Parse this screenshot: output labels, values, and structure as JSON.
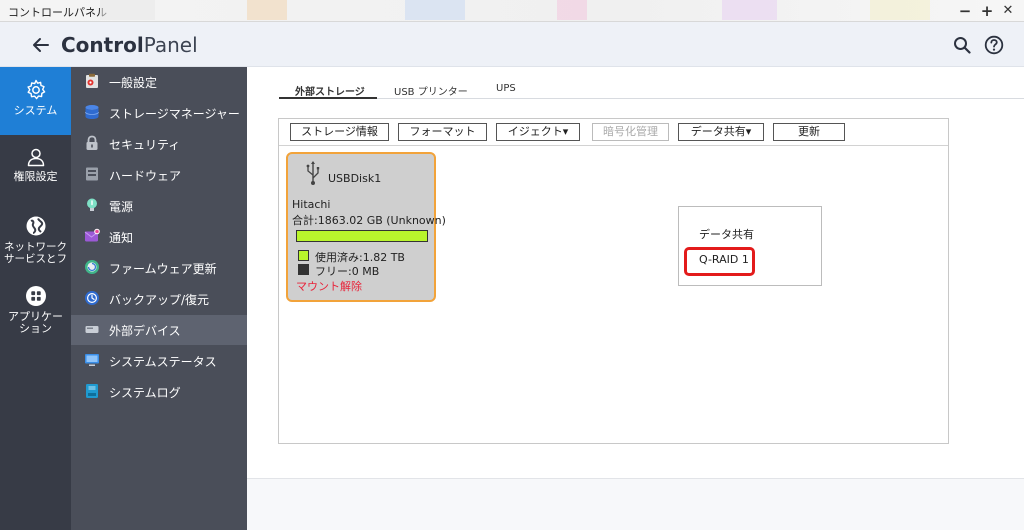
{
  "window": {
    "title": "コントロールパネル",
    "minimize": "−",
    "maximize": "+",
    "close": "✕"
  },
  "header": {
    "title_strong": "Control",
    "title_light": "Panel"
  },
  "primary_nav": [
    {
      "label": "システム",
      "icon": "gear-icon",
      "active": true
    },
    {
      "label": "権限設定",
      "icon": "user-icon",
      "active": false
    },
    {
      "label": "ネットワーク サービスとフ",
      "icon": "globe-icon",
      "active": false
    },
    {
      "label": "アプリケーション",
      "icon": "apps-icon",
      "active": false
    }
  ],
  "secondary_nav": [
    {
      "label": "一般設定",
      "icon": "settings-clipboard-icon"
    },
    {
      "label": "ストレージマネージャー",
      "icon": "storage-icon"
    },
    {
      "label": "セキュリティ",
      "icon": "lock-icon"
    },
    {
      "label": "ハードウェア",
      "icon": "hardware-icon"
    },
    {
      "label": "電源",
      "icon": "power-icon"
    },
    {
      "label": "通知",
      "icon": "notification-icon"
    },
    {
      "label": "ファームウェア更新",
      "icon": "firmware-update-icon"
    },
    {
      "label": "バックアップ/復元",
      "icon": "backup-icon"
    },
    {
      "label": "外部デバイス",
      "icon": "external-device-icon",
      "active": true
    },
    {
      "label": "システムステータス",
      "icon": "monitor-icon"
    },
    {
      "label": "システムログ",
      "icon": "log-icon"
    }
  ],
  "tabs": [
    {
      "label": "外部ストレージ",
      "active": true
    },
    {
      "label": "USB プリンター",
      "active": false
    },
    {
      "label": "UPS",
      "active": false
    }
  ],
  "toolbar": {
    "storage_info": "ストレージ情報",
    "format": "フォーマット",
    "eject": "イジェクト▾",
    "encryption": "暗号化管理",
    "data_share": "データ共有▾",
    "refresh": "更新"
  },
  "device": {
    "name": "USBDisk1",
    "vendor": "Hitachi",
    "total": "合計:1863.02 GB (Unknown)",
    "used_label": "使用済み:1.82 TB",
    "free_label": "フリー:0 MB",
    "used_fraction": 1.0,
    "unmount": "マウント解除",
    "used_color": "#b9f52c",
    "free_color": "#333333",
    "border_color": "#f2a33a"
  },
  "dropdown": {
    "items": [
      "データ共有",
      "Q-RAID 1"
    ],
    "highlight_color": "#e31b1b"
  },
  "colors": {
    "accent": "#1f7fd6",
    "sidebar_primary": "#373b46",
    "sidebar_secondary": "#4a4e59"
  }
}
